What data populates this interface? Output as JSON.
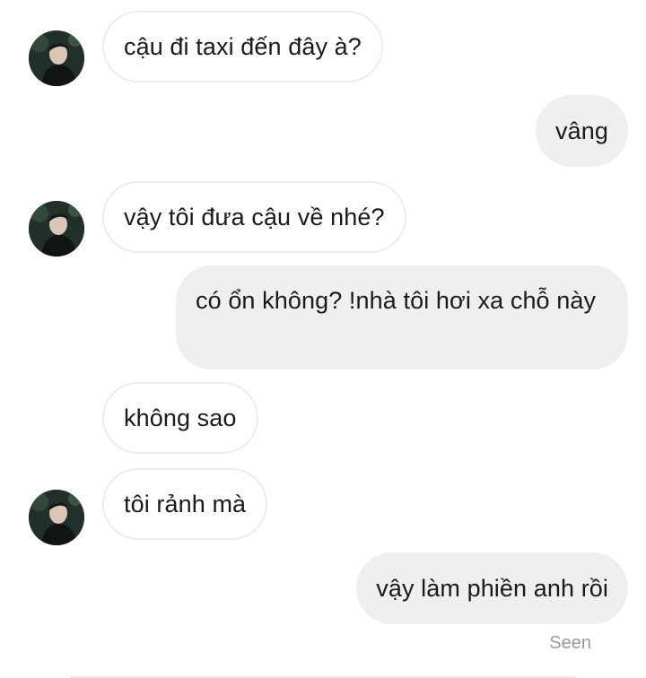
{
  "messages": [
    {
      "side": "in",
      "text": "cậu đi taxi đến đây à?"
    },
    {
      "side": "out",
      "text": "vâng"
    },
    {
      "side": "in",
      "text": "vậy tôi đưa cậu về nhé?"
    },
    {
      "side": "out",
      "text": "có ổn không? !nhà tôi hơi xa chỗ này"
    },
    {
      "side": "in",
      "text": "không sao"
    },
    {
      "side": "in",
      "text": "tôi rảnh mà"
    },
    {
      "side": "out",
      "text": "vậy làm phiền anh rồi"
    }
  ],
  "status": {
    "seen": "Seen"
  },
  "avatar": {
    "icon": "profile-photo"
  }
}
